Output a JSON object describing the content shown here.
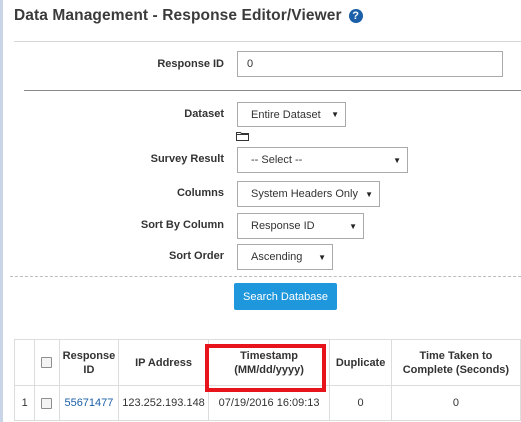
{
  "page": {
    "title": "Data Management - Response Editor/Viewer",
    "help_icon": "?"
  },
  "form": {
    "response_id": {
      "label": "Response ID",
      "value": "0"
    },
    "dataset": {
      "label": "Dataset",
      "value": "Entire Dataset"
    },
    "survey_result": {
      "label": "Survey Result",
      "value": "-- Select --"
    },
    "columns": {
      "label": "Columns",
      "value": "System Headers Only"
    },
    "sort_by_column": {
      "label": "Sort By Column",
      "value": "Response ID"
    },
    "sort_order": {
      "label": "Sort Order",
      "value": "Ascending"
    },
    "search_button": "Search Database"
  },
  "table": {
    "headers": {
      "response_id": "Response ID",
      "ip_address": "IP Address",
      "timestamp": "Timestamp (MM/dd/yyyy)",
      "duplicate": "Duplicate",
      "time_taken": "Time Taken to Complete (Seconds)"
    },
    "rows": [
      {
        "index": "1",
        "response_id": "55671477",
        "ip_address": "123.252.193.148",
        "timestamp": "07/19/2016 16:09:13",
        "duplicate": "0",
        "time_taken": "0"
      }
    ]
  },
  "colors": {
    "accent": "#1f97dc",
    "highlight": "#e8141c",
    "link": "#1a5fa8"
  }
}
